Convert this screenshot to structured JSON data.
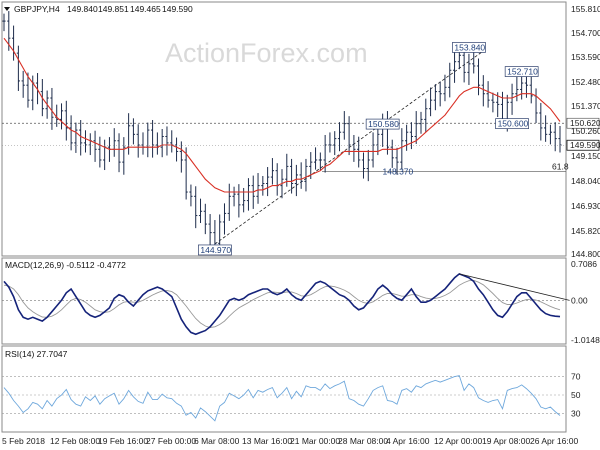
{
  "chart_data": {
    "type": "line",
    "header": {
      "symbol": "GBPJPY,H4",
      "ohlc": [
        "149.840",
        "149.851",
        "149.465",
        "149.590"
      ]
    },
    "watermark": "ActionForex.com",
    "x_labels": [
      "5 Feb 2018",
      "12 Feb 08:00",
      "19 Feb 16:00",
      "27 Feb 00:00",
      "6 Mar 08:00",
      "13 Mar 16:00",
      "21 Mar 00:00",
      "28 Mar 08:00",
      "4 Apr 16:00",
      "12 Apr 00:00",
      "19 Apr 08:00",
      "26 Apr 16:00"
    ],
    "price_panel": {
      "ylim": [
        144.5,
        156.2
      ],
      "yticks": [
        "155.810",
        "154.700",
        "153.590",
        "152.480",
        "151.370",
        "150.260",
        "149.150",
        "148.040",
        "146.930",
        "145.820",
        "144.800"
      ],
      "current_price": "149.590",
      "price_series": [
        155.4,
        154.6,
        153.9,
        152.6,
        152.4,
        151.7,
        152.5,
        152.1,
        151.3,
        151.8,
        150.9,
        150.8,
        151.2,
        150.4,
        149.7,
        150.3,
        149.7,
        149.6,
        149.8,
        149.4,
        148.9,
        149.5,
        149.4,
        149.8,
        148.8,
        149.5,
        150.5,
        150.1,
        149.6,
        149.5,
        150.3,
        149.6,
        149.5,
        150.0,
        149.7,
        149.6,
        149.3,
        148.9,
        147.4,
        147.2,
        146.3,
        146.5,
        145.9,
        145.5,
        145.0,
        146.0,
        146.4,
        147.2,
        147.3,
        146.8,
        147.0,
        147.7,
        147.2,
        147.7,
        147.8,
        148.1,
        148.4,
        147.7,
        148.0,
        148.6,
        147.8,
        148.2,
        147.9,
        148.6,
        148.8,
        148.9,
        148.9,
        149.6,
        149.6,
        149.9,
        150.2,
        150.6,
        149.6,
        149.4,
        148.9,
        148.5,
        148.9,
        149.6,
        150.1,
        150.6,
        149.5,
        149.0,
        148.8,
        149.8,
        150.2,
        150.0,
        150.6,
        150.8,
        151.3,
        151.7,
        152.1,
        152.0,
        152.3,
        153.1,
        153.5,
        153.8,
        153.0,
        153.4,
        153.3,
        152.4,
        152.0,
        151.7,
        151.6,
        151.5,
        150.7,
        151.6,
        152.0,
        152.2,
        152.5,
        152.4,
        151.9,
        151.1,
        150.4,
        150.1,
        150.2,
        149.9,
        149.6
      ],
      "ma_series": [
        154.6,
        154.3,
        154.0,
        153.6,
        153.2,
        152.8,
        152.5,
        152.2,
        151.8,
        151.5,
        151.2,
        150.9,
        150.7,
        150.5,
        150.3,
        150.2,
        150.0,
        149.9,
        149.8,
        149.7,
        149.6,
        149.5,
        149.4,
        149.4,
        149.4,
        149.4,
        149.5,
        149.5,
        149.5,
        149.5,
        149.5,
        149.5,
        149.5,
        149.6,
        149.6,
        149.6,
        149.5,
        149.4,
        149.2,
        148.9,
        148.6,
        148.3,
        148.0,
        147.8,
        147.6,
        147.5,
        147.4,
        147.4,
        147.4,
        147.4,
        147.4,
        147.4,
        147.4,
        147.5,
        147.5,
        147.6,
        147.7,
        147.7,
        147.8,
        147.9,
        147.9,
        148.0,
        148.0,
        148.1,
        148.2,
        148.3,
        148.4,
        148.6,
        148.7,
        148.9,
        149.1,
        149.3,
        149.3,
        149.3,
        149.3,
        149.3,
        149.3,
        149.3,
        149.3,
        149.4,
        149.4,
        149.4,
        149.4,
        149.5,
        149.6,
        149.7,
        149.8,
        150.0,
        150.2,
        150.4,
        150.6,
        150.8,
        151.0,
        151.3,
        151.6,
        151.9,
        152.1,
        152.2,
        152.3,
        152.3,
        152.2,
        152.1,
        152.0,
        151.9,
        151.8,
        151.8,
        151.8,
        151.9,
        152.0,
        152.0,
        152.0,
        151.9,
        151.7,
        151.5,
        151.3,
        151.0,
        150.7
      ],
      "levels": [
        {
          "label": "153.840",
          "x_index": 97,
          "value": 153.84,
          "box": true
        },
        {
          "label": "152.710",
          "x_index": 108,
          "value": 152.71,
          "box": true
        },
        {
          "label": "150.580",
          "x_index": 79,
          "value": 150.58,
          "box": true
        },
        {
          "label": "150.600",
          "x_index": 106,
          "value": 150.6,
          "box": true
        },
        {
          "label": "148.370",
          "x_index": 82,
          "value": 148.37,
          "box": false
        },
        {
          "label": "144.970",
          "x_index": 44,
          "value": 144.97,
          "box": true
        }
      ],
      "horizontal_lines": [
        {
          "label": "150.620",
          "value": 150.62,
          "style": "dotted"
        },
        {
          "label": "61.8",
          "value": 148.37,
          "style": "solid"
        }
      ],
      "trendline": {
        "from_index": 44,
        "from_value": 144.97,
        "to_index": 100,
        "to_value": 154.0
      }
    },
    "macd_panel": {
      "label": "MACD(12,26,9) -0.5112 -0.4772",
      "ylim": [
        -1.05,
        0.75
      ],
      "yticks": [
        "0.7086",
        "0.00",
        "-1.0148"
      ],
      "macd_series": [
        0.5,
        0.35,
        0.1,
        -0.25,
        -0.45,
        -0.5,
        -0.45,
        -0.5,
        -0.55,
        -0.45,
        -0.3,
        -0.15,
        0.0,
        0.2,
        0.3,
        0.1,
        -0.1,
        -0.3,
        -0.4,
        -0.45,
        -0.4,
        -0.3,
        -0.2,
        0.05,
        0.15,
        0.1,
        -0.05,
        -0.15,
        0.0,
        0.15,
        0.25,
        0.3,
        0.35,
        0.3,
        0.2,
        0.1,
        -0.2,
        -0.5,
        -0.7,
        -0.85,
        -0.9,
        -0.85,
        -0.8,
        -0.7,
        -0.55,
        -0.4,
        -0.2,
        0.0,
        0.05,
        0.0,
        0.05,
        0.15,
        0.2,
        0.25,
        0.3,
        0.3,
        0.2,
        0.15,
        0.2,
        0.3,
        0.15,
        0.05,
        0.0,
        0.15,
        0.3,
        0.45,
        0.5,
        0.45,
        0.35,
        0.25,
        0.15,
        0.1,
        0.0,
        -0.15,
        -0.25,
        -0.2,
        -0.05,
        0.1,
        0.3,
        0.4,
        0.3,
        0.15,
        0.05,
        0.0,
        0.15,
        0.3,
        0.1,
        -0.05,
        -0.05,
        0.0,
        0.1,
        0.2,
        0.3,
        0.45,
        0.6,
        0.7,
        0.65,
        0.6,
        0.5,
        0.3,
        0.15,
        -0.05,
        -0.25,
        -0.4,
        -0.45,
        -0.3,
        -0.1,
        0.1,
        0.2,
        0.2,
        0.05,
        -0.1,
        -0.25,
        -0.35,
        -0.4,
        -0.42,
        -0.43
      ],
      "signal_series": [
        0.4,
        0.38,
        0.3,
        0.15,
        -0.05,
        -0.2,
        -0.3,
        -0.38,
        -0.44,
        -0.45,
        -0.42,
        -0.35,
        -0.25,
        -0.12,
        0.0,
        0.05,
        0.02,
        -0.05,
        -0.15,
        -0.25,
        -0.3,
        -0.32,
        -0.3,
        -0.22,
        -0.12,
        -0.05,
        -0.03,
        -0.05,
        -0.05,
        0.0,
        0.07,
        0.14,
        0.2,
        0.25,
        0.26,
        0.23,
        0.15,
        0.0,
        -0.15,
        -0.32,
        -0.48,
        -0.6,
        -0.68,
        -0.72,
        -0.7,
        -0.64,
        -0.55,
        -0.42,
        -0.3,
        -0.2,
        -0.13,
        -0.06,
        0.02,
        0.08,
        0.14,
        0.2,
        0.22,
        0.21,
        0.2,
        0.22,
        0.22,
        0.18,
        0.12,
        0.11,
        0.15,
        0.22,
        0.3,
        0.36,
        0.38,
        0.36,
        0.32,
        0.27,
        0.2,
        0.1,
        0.0,
        -0.06,
        -0.08,
        -0.04,
        0.04,
        0.13,
        0.18,
        0.18,
        0.15,
        0.11,
        0.11,
        0.15,
        0.15,
        0.1,
        0.06,
        0.04,
        0.05,
        0.08,
        0.13,
        0.2,
        0.3,
        0.4,
        0.47,
        0.52,
        0.53,
        0.48,
        0.41,
        0.3,
        0.18,
        0.05,
        -0.06,
        -0.11,
        -0.11,
        -0.07,
        -0.02,
        0.02,
        0.03,
        0.01,
        -0.04,
        -0.1,
        -0.16,
        -0.21,
        -0.25
      ],
      "trendline": {
        "from_index": 95,
        "from_value": 0.7,
        "to_index": 118,
        "to_value": 0.0
      }
    },
    "rsi_panel": {
      "label": "RSI(14) 27.7047",
      "ylim": [
        12,
        88
      ],
      "yticks": [
        "70",
        "50",
        "30"
      ],
      "rsi_series": [
        58,
        52,
        44,
        38,
        31,
        35,
        42,
        40,
        35,
        44,
        38,
        46,
        50,
        56,
        45,
        40,
        38,
        48,
        44,
        49,
        40,
        46,
        49,
        52,
        40,
        46,
        55,
        48,
        43,
        41,
        53,
        45,
        45,
        51,
        47,
        46,
        41,
        38,
        28,
        31,
        25,
        36,
        32,
        27,
        22,
        38,
        42,
        52,
        49,
        46,
        50,
        56,
        47,
        55,
        53,
        56,
        58,
        47,
        52,
        58,
        46,
        54,
        48,
        60,
        58,
        58,
        55,
        62,
        57,
        60,
        62,
        65,
        46,
        44,
        40,
        38,
        46,
        55,
        58,
        60,
        44,
        43,
        40,
        55,
        57,
        53,
        60,
        58,
        62,
        64,
        66,
        64,
        66,
        68,
        70,
        71,
        55,
        62,
        58,
        47,
        44,
        42,
        44,
        45,
        35,
        55,
        57,
        58,
        61,
        57,
        52,
        46,
        37,
        35,
        37,
        32,
        27.7
      ]
    }
  }
}
